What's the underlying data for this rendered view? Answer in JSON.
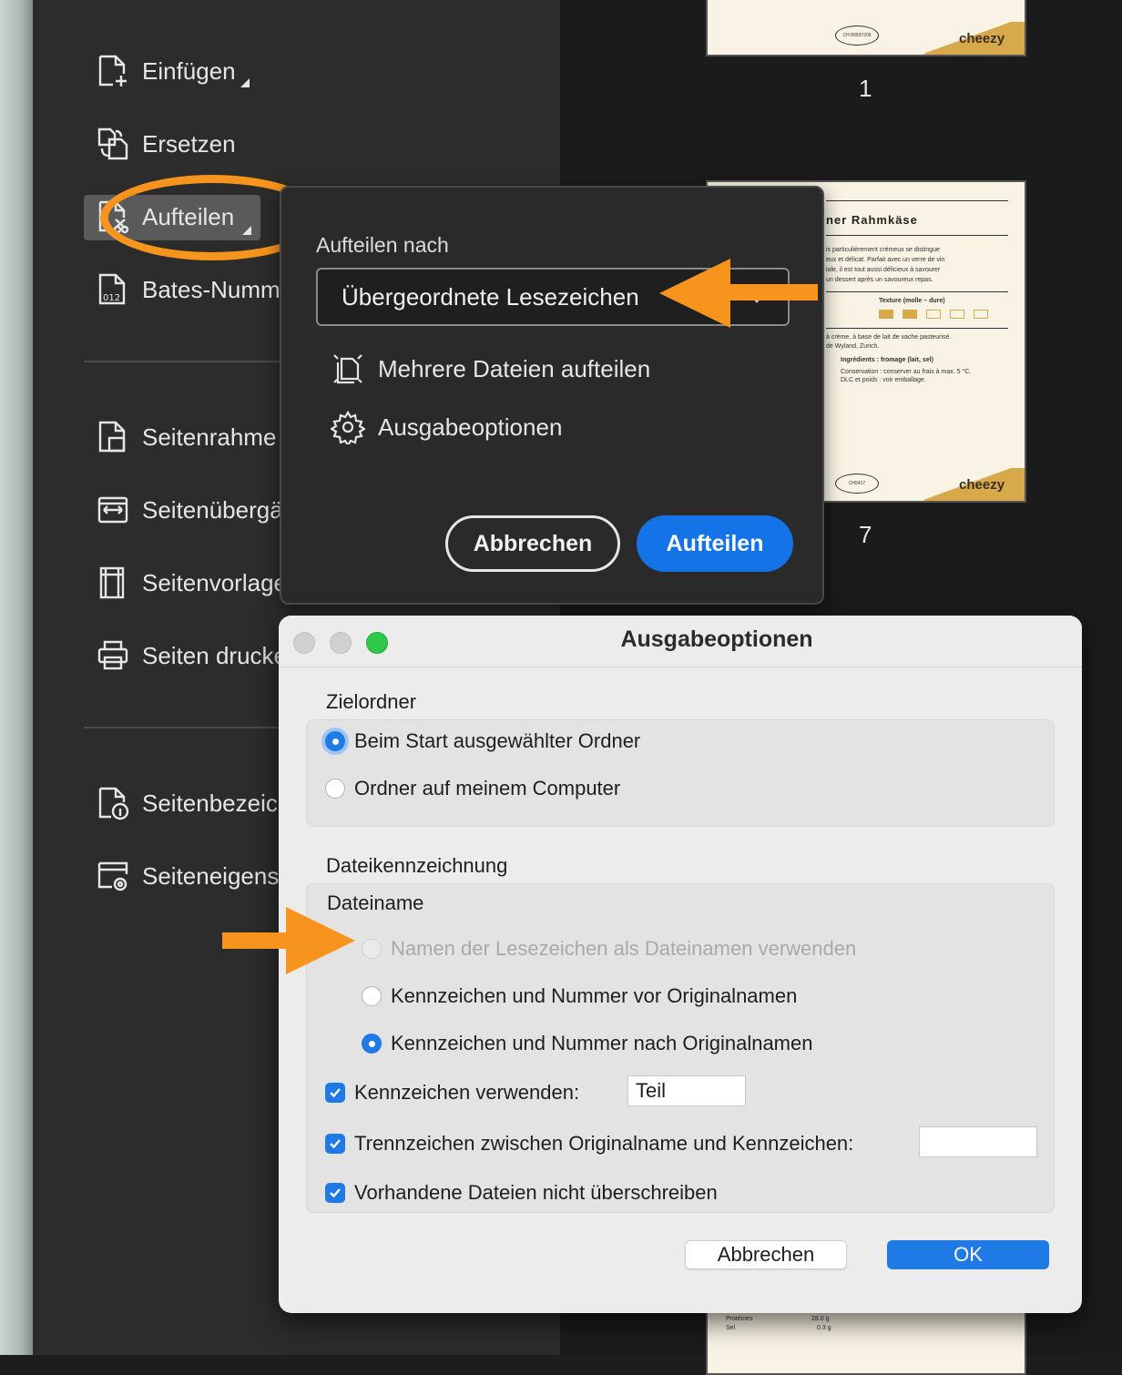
{
  "tools_panel": {
    "items": [
      {
        "label": "Einfügen",
        "icon": "insert-page-icon"
      },
      {
        "label": "Ersetzen",
        "icon": "replace-page-icon"
      },
      {
        "label": "Aufteilen",
        "icon": "split-page-icon"
      },
      {
        "label": "Bates-Numm",
        "icon": "bates-number-icon"
      },
      {
        "label": "Seitenrahme",
        "icon": "page-box-icon"
      },
      {
        "label": "Seitenübergä",
        "icon": "page-transition-icon"
      },
      {
        "label": "Seitenvorlage",
        "icon": "page-template-icon"
      },
      {
        "label": "Seiten drucke",
        "icon": "print-pages-icon"
      },
      {
        "label": "Seitenbezeic",
        "icon": "page-label-icon"
      },
      {
        "label": "Seiteneigens",
        "icon": "page-properties-icon"
      }
    ]
  },
  "thumbnails": {
    "page1": {
      "number": "1",
      "brand": "cheezy",
      "code": "CH 80937209"
    },
    "page7": {
      "number": "7",
      "brand": "cheezy",
      "code": "CH5417",
      "title": "ner Rahmkäse",
      "lines": [
        "is particulièrement crémeux se distingue",
        "eux et délicat. Parfait avec un verre de vin",
        "iale, il est tout aussi délicieux à savourer",
        " un dessert après un savoureux repas."
      ],
      "texture": "Texture (molle – dure)",
      "line2a": "à crème, à base de lait de vache pasteurisé.",
      "line2b": "de Wyland, Zurich.",
      "ingredients": "Ingrédients : fromage (lait, sel)",
      "conservation": "Conservation : conserver au frais à max. 5 °C.",
      "dlc": "DLC et poids : voir emballage.",
      "bottom_rows": [
        {
          "label": "Protéines",
          "value": "28.0 g"
        },
        {
          "label": "Sel",
          "value": "0.3 g"
        }
      ]
    }
  },
  "split_popup": {
    "label": "Aufteilen nach",
    "select_value": "Übergeordnete Lesezeichen",
    "options": [
      {
        "label": "Mehrere Dateien aufteilen",
        "icon": "split-multiple-files-icon"
      },
      {
        "label": "Ausgabeoptionen",
        "icon": "gear-icon"
      }
    ],
    "cancel_label": "Abbrechen",
    "split_label": "Aufteilen"
  },
  "output_dialog": {
    "title": "Ausgabeoptionen",
    "target_folder": {
      "label": "Zielordner",
      "options": [
        {
          "label": "Beim Start ausgewählter Ordner",
          "selected": true
        },
        {
          "label": "Ordner auf meinem Computer",
          "selected": false
        }
      ]
    },
    "file_labeling": {
      "label": "Dateikennzeichnung",
      "filename_label": "Dateiname",
      "options": [
        {
          "label": "Namen der Lesezeichen als Dateinamen verwenden",
          "selected": false,
          "disabled": true
        },
        {
          "label": "Kennzeichen und Nummer vor Originalnamen",
          "selected": false,
          "disabled": false
        },
        {
          "label": "Kennzeichen und Nummer nach Originalnamen",
          "selected": true,
          "disabled": false
        }
      ],
      "use_label": {
        "label": "Kennzeichen verwenden:",
        "checked": true,
        "value": "Teil"
      },
      "separator": {
        "label": "Trennzeichen zwischen Originalname und Kennzeichen:",
        "checked": true,
        "value": ""
      },
      "no_overwrite": {
        "label": "Vorhandene Dateien nicht überschreiben",
        "checked": true
      }
    },
    "cancel_label": "Abbrechen",
    "ok_label": "OK"
  },
  "colors": {
    "accent_orange": "#f7941d",
    "acrobat_blue": "#1473e6",
    "mac_blue": "#1f7ae6",
    "panel_bg": "#2c2c2c"
  }
}
